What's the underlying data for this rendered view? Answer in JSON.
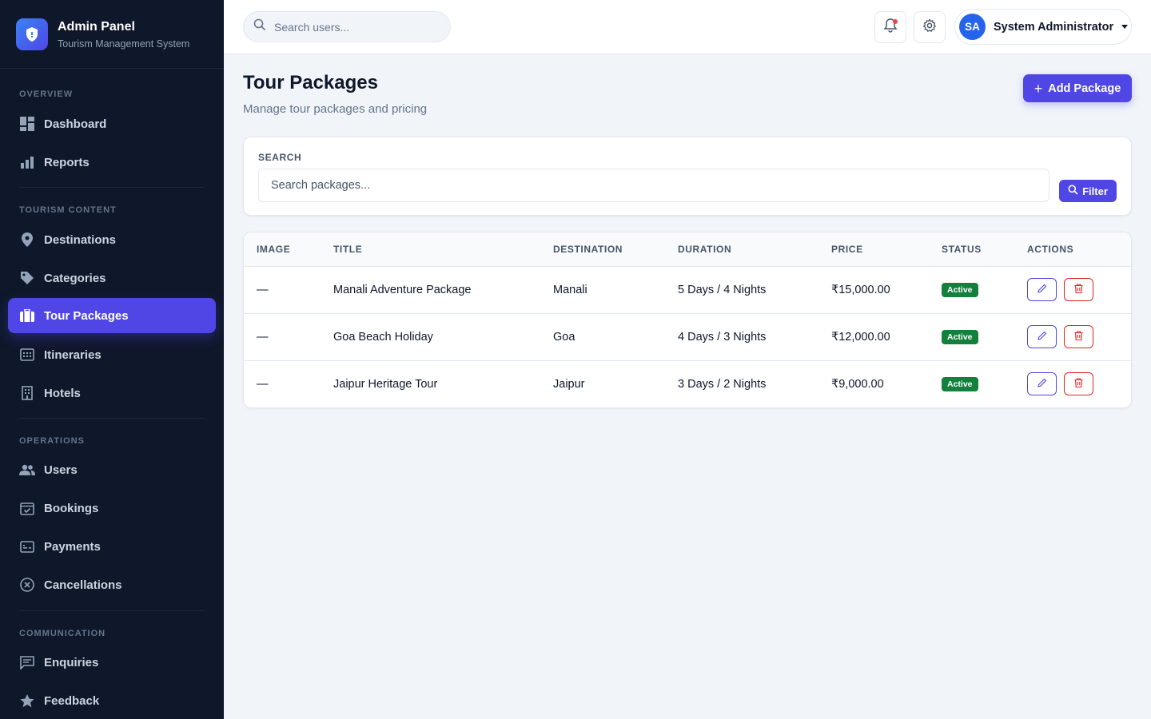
{
  "brand": {
    "title": "Admin Panel",
    "subtitle": "Tourism Management System"
  },
  "sidebar": {
    "sections": {
      "overview": "OVERVIEW",
      "tourism": "TOURISM CONTENT",
      "operations": "OPERATIONS",
      "communication": "COMMUNICATION"
    },
    "items": {
      "dashboard": "Dashboard",
      "reports": "Reports",
      "destinations": "Destinations",
      "categories": "Categories",
      "tour_packages": "Tour Packages",
      "itineraries": "Itineraries",
      "hotels": "Hotels",
      "users": "Users",
      "bookings": "Bookings",
      "payments": "Payments",
      "cancellations": "Cancellations",
      "enquiries": "Enquiries",
      "feedback": "Feedback"
    },
    "active": "Tour Packages"
  },
  "header": {
    "search_placeholder": "Search users...",
    "user": {
      "initials": "SA",
      "name": "System Administrator"
    }
  },
  "page": {
    "title": "Tour Packages",
    "subtitle": "Manage tour packages and pricing",
    "add_button": "Add Package"
  },
  "filter": {
    "label": "SEARCH",
    "placeholder": "Search packages...",
    "button": "Filter"
  },
  "table": {
    "columns": {
      "image": "IMAGE",
      "title": "TITLE",
      "destination": "DESTINATION",
      "duration": "DURATION",
      "price": "PRICE",
      "status": "STATUS",
      "actions": "ACTIONS"
    },
    "rows": [
      {
        "image": "—",
        "title": "Manali Adventure Package",
        "destination": "Manali",
        "duration": "5 Days / 4 Nights",
        "price": "₹15,000.00",
        "status": "Active"
      },
      {
        "image": "—",
        "title": "Goa Beach Holiday",
        "destination": "Goa",
        "duration": "4 Days / 3 Nights",
        "price": "₹12,000.00",
        "status": "Active"
      },
      {
        "image": "—",
        "title": "Jaipur Heritage Tour",
        "destination": "Jaipur",
        "duration": "3 Days / 2 Nights",
        "price": "₹9,000.00",
        "status": "Active"
      }
    ]
  },
  "colors": {
    "accent": "#4f46e5",
    "sidebar_bg": "#0f172a",
    "active_badge": "#15803d",
    "danger": "#dc2626"
  }
}
